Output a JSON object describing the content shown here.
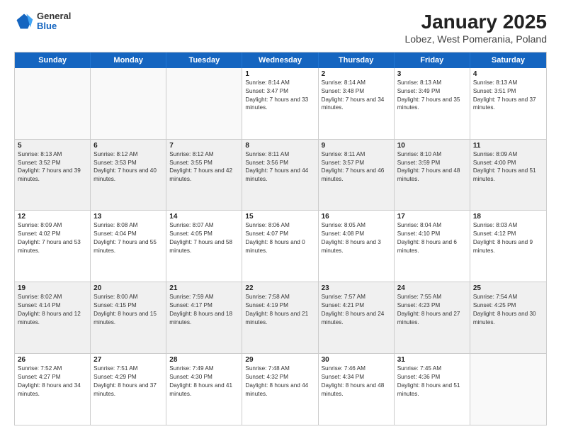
{
  "header": {
    "logo_general": "General",
    "logo_blue": "Blue",
    "title": "January 2025",
    "subtitle": "Lobez, West Pomerania, Poland"
  },
  "days_of_week": [
    "Sunday",
    "Monday",
    "Tuesday",
    "Wednesday",
    "Thursday",
    "Friday",
    "Saturday"
  ],
  "weeks": [
    [
      {
        "day": "",
        "empty": true
      },
      {
        "day": "",
        "empty": true
      },
      {
        "day": "",
        "empty": true
      },
      {
        "day": "1",
        "sunrise": "8:14 AM",
        "sunset": "3:47 PM",
        "daylight": "7 hours and 33 minutes."
      },
      {
        "day": "2",
        "sunrise": "8:14 AM",
        "sunset": "3:48 PM",
        "daylight": "7 hours and 34 minutes."
      },
      {
        "day": "3",
        "sunrise": "8:13 AM",
        "sunset": "3:49 PM",
        "daylight": "7 hours and 35 minutes."
      },
      {
        "day": "4",
        "sunrise": "8:13 AM",
        "sunset": "3:51 PM",
        "daylight": "7 hours and 37 minutes."
      }
    ],
    [
      {
        "day": "5",
        "sunrise": "8:13 AM",
        "sunset": "3:52 PM",
        "daylight": "7 hours and 39 minutes."
      },
      {
        "day": "6",
        "sunrise": "8:12 AM",
        "sunset": "3:53 PM",
        "daylight": "7 hours and 40 minutes."
      },
      {
        "day": "7",
        "sunrise": "8:12 AM",
        "sunset": "3:55 PM",
        "daylight": "7 hours and 42 minutes."
      },
      {
        "day": "8",
        "sunrise": "8:11 AM",
        "sunset": "3:56 PM",
        "daylight": "7 hours and 44 minutes."
      },
      {
        "day": "9",
        "sunrise": "8:11 AM",
        "sunset": "3:57 PM",
        "daylight": "7 hours and 46 minutes."
      },
      {
        "day": "10",
        "sunrise": "8:10 AM",
        "sunset": "3:59 PM",
        "daylight": "7 hours and 48 minutes."
      },
      {
        "day": "11",
        "sunrise": "8:09 AM",
        "sunset": "4:00 PM",
        "daylight": "7 hours and 51 minutes."
      }
    ],
    [
      {
        "day": "12",
        "sunrise": "8:09 AM",
        "sunset": "4:02 PM",
        "daylight": "7 hours and 53 minutes."
      },
      {
        "day": "13",
        "sunrise": "8:08 AM",
        "sunset": "4:04 PM",
        "daylight": "7 hours and 55 minutes."
      },
      {
        "day": "14",
        "sunrise": "8:07 AM",
        "sunset": "4:05 PM",
        "daylight": "7 hours and 58 minutes."
      },
      {
        "day": "15",
        "sunrise": "8:06 AM",
        "sunset": "4:07 PM",
        "daylight": "8 hours and 0 minutes."
      },
      {
        "day": "16",
        "sunrise": "8:05 AM",
        "sunset": "4:08 PM",
        "daylight": "8 hours and 3 minutes."
      },
      {
        "day": "17",
        "sunrise": "8:04 AM",
        "sunset": "4:10 PM",
        "daylight": "8 hours and 6 minutes."
      },
      {
        "day": "18",
        "sunrise": "8:03 AM",
        "sunset": "4:12 PM",
        "daylight": "8 hours and 9 minutes."
      }
    ],
    [
      {
        "day": "19",
        "sunrise": "8:02 AM",
        "sunset": "4:14 PM",
        "daylight": "8 hours and 12 minutes."
      },
      {
        "day": "20",
        "sunrise": "8:00 AM",
        "sunset": "4:15 PM",
        "daylight": "8 hours and 15 minutes."
      },
      {
        "day": "21",
        "sunrise": "7:59 AM",
        "sunset": "4:17 PM",
        "daylight": "8 hours and 18 minutes."
      },
      {
        "day": "22",
        "sunrise": "7:58 AM",
        "sunset": "4:19 PM",
        "daylight": "8 hours and 21 minutes."
      },
      {
        "day": "23",
        "sunrise": "7:57 AM",
        "sunset": "4:21 PM",
        "daylight": "8 hours and 24 minutes."
      },
      {
        "day": "24",
        "sunrise": "7:55 AM",
        "sunset": "4:23 PM",
        "daylight": "8 hours and 27 minutes."
      },
      {
        "day": "25",
        "sunrise": "7:54 AM",
        "sunset": "4:25 PM",
        "daylight": "8 hours and 30 minutes."
      }
    ],
    [
      {
        "day": "26",
        "sunrise": "7:52 AM",
        "sunset": "4:27 PM",
        "daylight": "8 hours and 34 minutes."
      },
      {
        "day": "27",
        "sunrise": "7:51 AM",
        "sunset": "4:29 PM",
        "daylight": "8 hours and 37 minutes."
      },
      {
        "day": "28",
        "sunrise": "7:49 AM",
        "sunset": "4:30 PM",
        "daylight": "8 hours and 41 minutes."
      },
      {
        "day": "29",
        "sunrise": "7:48 AM",
        "sunset": "4:32 PM",
        "daylight": "8 hours and 44 minutes."
      },
      {
        "day": "30",
        "sunrise": "7:46 AM",
        "sunset": "4:34 PM",
        "daylight": "8 hours and 48 minutes."
      },
      {
        "day": "31",
        "sunrise": "7:45 AM",
        "sunset": "4:36 PM",
        "daylight": "8 hours and 51 minutes."
      },
      {
        "day": "",
        "empty": true
      }
    ]
  ]
}
